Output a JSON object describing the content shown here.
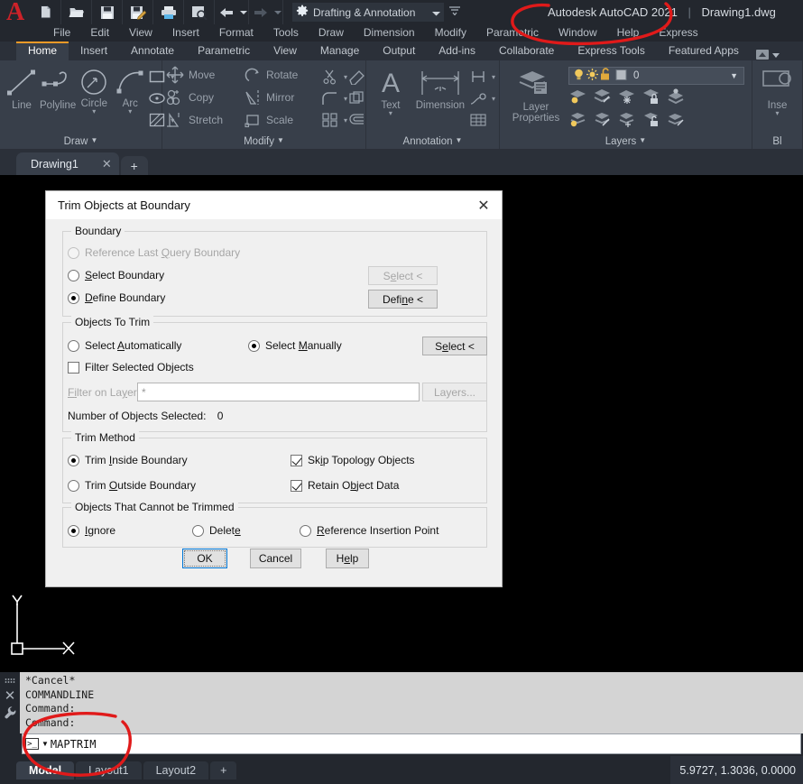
{
  "titlebar": {
    "logo": "autocad-logo",
    "quick_access": [
      "new-icon",
      "open-icon",
      "save-icon",
      "saveas-icon",
      "plot-icon",
      "plot-preview-icon",
      "undo-icon",
      "undo-dropdown-icon",
      "redo-icon",
      "redo-dropdown-icon"
    ],
    "workspace": "Drafting & Annotation",
    "app_title": "Autodesk AutoCAD 2021",
    "document_title": "Drawing1.dwg"
  },
  "menubar": {
    "items": [
      "File",
      "Edit",
      "View",
      "Insert",
      "Format",
      "Tools",
      "Draw",
      "Dimension",
      "Modify",
      "Parametric",
      "Window",
      "Help",
      "Express"
    ]
  },
  "ribbon": {
    "tabs": [
      "Home",
      "Insert",
      "Annotate",
      "Parametric",
      "View",
      "Manage",
      "Output",
      "Add-ins",
      "Collaborate",
      "Express Tools",
      "Featured Apps"
    ],
    "active_tab": "Home",
    "panels": [
      {
        "label": "Draw",
        "buttons": [
          "Line",
          "Polyline",
          "Circle",
          "Arc"
        ],
        "small": [
          "rectangle-icon",
          "ellipse-icon",
          "hatch-icon"
        ]
      },
      {
        "label": "Modify",
        "buttons": [
          "Move",
          "Rotate",
          "Copy",
          "Mirror",
          "Stretch",
          "Scale"
        ],
        "small": [
          "trim-icon",
          "fillet-icon",
          "array-icon",
          "explode-icon",
          "break-icon",
          "offset-icon"
        ]
      },
      {
        "label": "Annotation",
        "buttons": [
          "Text",
          "Dimension"
        ],
        "small": [
          "dim-linear-icon",
          "leader-icon",
          "table-icon"
        ]
      },
      {
        "label": "Layers",
        "buttons": [
          "Layer Properties"
        ],
        "layer_current": "0",
        "layer_states": [
          "lightbulb-icon",
          "sun-icon",
          "unlock-icon",
          "color-swatch-icon"
        ]
      },
      {
        "label": "Bl",
        "buttons": [
          "Inse"
        ]
      }
    ]
  },
  "drawing_tabs": {
    "tabs": [
      {
        "name": "Drawing1",
        "close": "✕"
      }
    ],
    "add": "+"
  },
  "ucs": {
    "x_label": "X",
    "y_label": "Y"
  },
  "dialog": {
    "title": "Trim Objects at Boundary",
    "close": "✕",
    "groups": {
      "boundary": {
        "title": "Boundary",
        "options": [
          {
            "label_pre": "Reference Last ",
            "label_key": "Q",
            "label_post": "uery Boundary",
            "checked": false,
            "disabled": true
          },
          {
            "label_pre": "",
            "label_key": "S",
            "label_post": "elect Boundary",
            "checked": false,
            "disabled": false
          },
          {
            "label_pre": "",
            "label_key": "D",
            "label_post": "efine Boundary",
            "checked": true,
            "disabled": false
          }
        ],
        "select_button": {
          "pre": "S",
          "key": "e",
          "post": "lect <",
          "disabled": true
        },
        "define_button": {
          "pre": "Defi",
          "key": "n",
          "post": "e <",
          "disabled": false
        }
      },
      "objects_to_trim": {
        "title": "Objects To Trim",
        "auto": {
          "pre": "Select ",
          "key": "A",
          "post": "utomatically",
          "checked": false
        },
        "manual": {
          "pre": "Select ",
          "key": "M",
          "post": "anually",
          "checked": true
        },
        "select_button": {
          "pre": "S",
          "key": "e",
          "post": "lect <",
          "disabled": false
        },
        "filter_checkbox": {
          "label": "Filter Selected Objects",
          "checked": false
        },
        "filter_layers_label_pre": "F",
        "filter_layers_label_key": "i",
        "filter_layers_label_post": "lter on La",
        "filter_layers_label": "Filter on Layers:",
        "filter_layers_value": "*",
        "layers_button": "Layers...",
        "count_label": "Number of Objects Selected:",
        "count_value": "0"
      },
      "trim_method": {
        "title": "Trim Method",
        "inside": {
          "pre": "Trim ",
          "key": "I",
          "post": "nside Boundary",
          "checked": true
        },
        "outside": {
          "pre": "Trim ",
          "key": "O",
          "post": "utside Boundary",
          "checked": false
        },
        "skip_topology": {
          "pre": "Sk",
          "key": "i",
          "post": "p Topology Objects",
          "checked": true
        },
        "retain_data": {
          "pre": "Retain O",
          "key": "b",
          "post": "ject Data",
          "checked": true
        }
      },
      "cannot_be_trimmed": {
        "title": "Objects That Cannot be Trimmed",
        "ignore": {
          "pre": "",
          "key": "I",
          "post": "gnore",
          "checked": true
        },
        "delete": {
          "pre": "Delet",
          "key": "e",
          "post": "",
          "checked": false
        },
        "reference": {
          "pre": "",
          "key": "R",
          "post": "eference Insertion Point",
          "checked": false
        }
      }
    },
    "buttons": {
      "ok": "OK",
      "cancel": "Cancel",
      "help_pre": "H",
      "help_key": "e",
      "help_post": "lp"
    }
  },
  "command_line": {
    "history": [
      "*Cancel*",
      "COMMANDLINE",
      "Command:",
      "Command:"
    ],
    "input_value": "MAPTRIM",
    "prompt_icon": "command-prompt-icon"
  },
  "status_bar": {
    "layout_tabs": [
      "Model",
      "Layout1",
      "Layout2"
    ],
    "active_layout": "Model",
    "add_layout": "+",
    "coordinates": "5.9727, 1.3036, 0.0000"
  },
  "annotations": {
    "color": "#e01a1a",
    "circles": [
      "title-highlight",
      "maptrim-highlight"
    ]
  }
}
